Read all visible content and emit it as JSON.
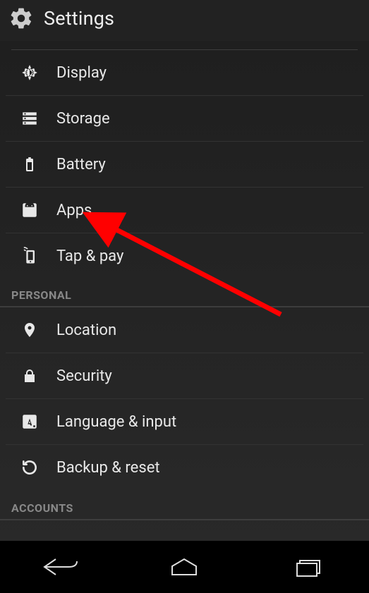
{
  "header": {
    "title": "Settings"
  },
  "device_section": {
    "items": [
      {
        "id": "display",
        "label": "Display",
        "icon": "brightness-icon"
      },
      {
        "id": "storage",
        "label": "Storage",
        "icon": "storage-icon"
      },
      {
        "id": "battery",
        "label": "Battery",
        "icon": "battery-icon"
      },
      {
        "id": "apps",
        "label": "Apps",
        "icon": "apps-icon"
      },
      {
        "id": "tappay",
        "label": "Tap & pay",
        "icon": "tap-pay-icon"
      }
    ]
  },
  "personal_section": {
    "header": "PERSONAL",
    "items": [
      {
        "id": "location",
        "label": "Location",
        "icon": "location-pin-icon"
      },
      {
        "id": "security",
        "label": "Security",
        "icon": "lock-icon"
      },
      {
        "id": "language",
        "label": "Language & input",
        "icon": "language-icon"
      },
      {
        "id": "backup",
        "label": "Backup & reset",
        "icon": "backup-icon"
      }
    ]
  },
  "accounts_section": {
    "header": "ACCOUNTS"
  },
  "annotation": {
    "arrow_target": "apps"
  }
}
